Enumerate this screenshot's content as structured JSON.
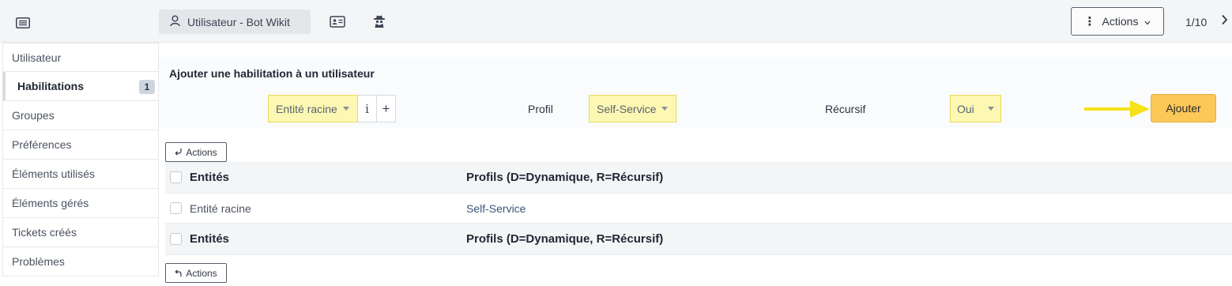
{
  "header": {
    "list_icon": "list-icon",
    "active_tab": {
      "icon": "user-icon",
      "label": "Utilisateur - Bot Wikit"
    },
    "tab_icons": [
      "id-card-icon",
      "spy-icon"
    ],
    "actions_label": "Actions",
    "actions_icon": "vertical-dots-icon",
    "pager": "1/10",
    "next_icon": "chevron-right-icon"
  },
  "sidebar": {
    "items": [
      {
        "label": "Utilisateur"
      },
      {
        "label": "Habilitations",
        "badge": "1",
        "active": true
      },
      {
        "label": "Groupes"
      },
      {
        "label": "Préférences"
      },
      {
        "label": "Éléments utilisés"
      },
      {
        "label": "Éléments gérés"
      },
      {
        "label": "Tickets créés"
      },
      {
        "label": "Problèmes"
      }
    ]
  },
  "form": {
    "title": "Ajouter une habilitation à un utilisateur",
    "entity_value": "Entité racine",
    "info_glyph": "i",
    "plus_glyph": "+",
    "profil_label": "Profil",
    "profil_value": "Self-Service",
    "recursif_label": "Récursif",
    "recursif_value": "Oui",
    "add_label": "Ajouter",
    "highlight_color": "#fcf8b3",
    "add_color": "#fcc857",
    "arrow_color": "#f5e21a"
  },
  "table": {
    "mass_actions_label": "Actions",
    "headers": [
      "Entités",
      "Profils (D=Dynamique, R=Récursif)"
    ],
    "rows": [
      [
        "Entité racine",
        "Self-Service"
      ]
    ],
    "footer": [
      "Entités",
      "Profils (D=Dynamique, R=Récursif)"
    ]
  }
}
